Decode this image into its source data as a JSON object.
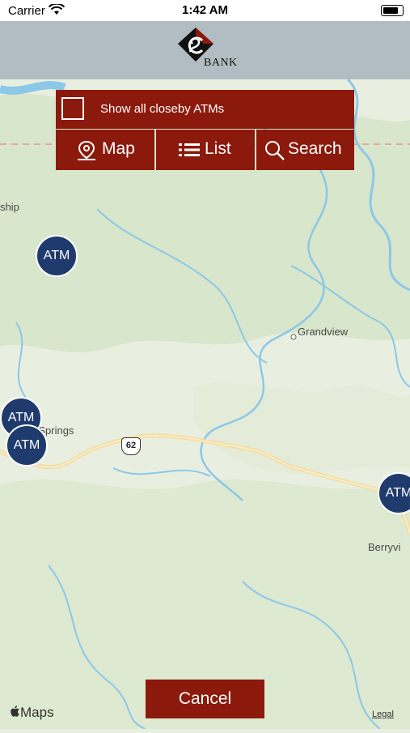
{
  "status_bar": {
    "carrier": "Carrier",
    "time": "1:42 AM"
  },
  "header": {
    "logo_text": "BANK"
  },
  "controls": {
    "checkbox_label": "Show all closeby ATMs",
    "checked": false,
    "tabs": [
      {
        "label": "Map",
        "icon": "map-pin-icon"
      },
      {
        "label": "List",
        "icon": "list-icon"
      },
      {
        "label": "Search",
        "icon": "magnifier-icon"
      }
    ]
  },
  "map": {
    "labels": {
      "township": "ship",
      "grandview": "Grandview",
      "springs": "ka Springs",
      "berryville": "Berryvi",
      "route": "62"
    },
    "pins": [
      {
        "label": "ATM"
      },
      {
        "label": "ATM"
      },
      {
        "label": "ATM"
      },
      {
        "label": "ATM"
      }
    ]
  },
  "footer": {
    "cancel_label": "Cancel",
    "maps_brand": "Maps",
    "legal_label": "Legal"
  },
  "colors": {
    "accent": "#8b1a0c",
    "pin": "#1f3a6d",
    "header": "#b2bcc3"
  }
}
